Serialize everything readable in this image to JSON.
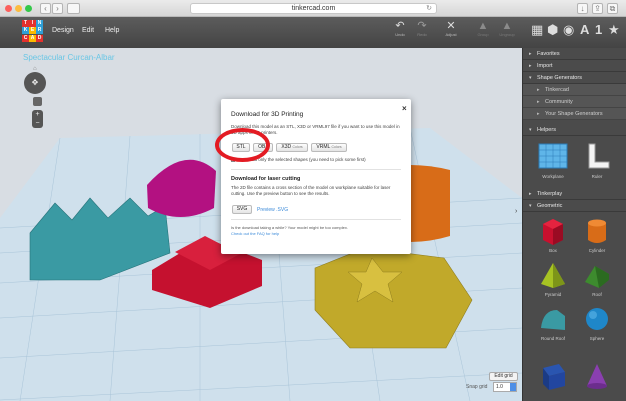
{
  "browser": {
    "url": "tinkercad.com",
    "back": "‹",
    "forward": "›",
    "reload": "↻",
    "share_icon": "share-icon",
    "colors": {
      "close": "#fc605c",
      "minimize": "#fdbc40",
      "zoom": "#34c84a"
    }
  },
  "app": {
    "logo_letters": [
      "T",
      "I",
      "N",
      "K",
      "E",
      "R",
      "C",
      "A",
      "D"
    ],
    "logo_colors": [
      "#e3312d",
      "#e3312d",
      "#2e9fd7",
      "#2e9fd7",
      "#fbb900",
      "#2e9fd7",
      "#e3312d",
      "#fbb900",
      "#e3312d"
    ],
    "menus": [
      "Design",
      "Edit",
      "Help"
    ],
    "tools": [
      {
        "label": "Undo",
        "glyph": "↶"
      },
      {
        "label": "Redo",
        "glyph": "↷"
      },
      {
        "label": "Adjust",
        "glyph": "✕"
      },
      {
        "label": "Group",
        "glyph": "▲"
      },
      {
        "label": "Ungroup",
        "glyph": "▲"
      }
    ],
    "accent": "#69c6e5"
  },
  "workplane": {
    "project_title": "Spectacular Curcan-Albar",
    "edit_grid": "Edit grid",
    "snap_label": "Snap grid",
    "snap_value": "1.0"
  },
  "panel": {
    "sections": [
      {
        "label": "Favorites",
        "expanded": false
      },
      {
        "label": "Import",
        "expanded": false
      },
      {
        "label": "Shape Generators",
        "expanded": true
      }
    ],
    "generators": [
      "Tinkercad",
      "Community",
      "Your Shape Generators"
    ],
    "helpers_title": "Helpers",
    "helpers": [
      "Workplane",
      "Ruler"
    ],
    "tinkerplay": "Tinkerplay",
    "geometric": "Geometric",
    "shapes": [
      "Box",
      "Cylinder",
      "Pyramid",
      "Roof",
      "Round Roof",
      "Sphere"
    ]
  },
  "modal": {
    "title": "Download for 3D Printing",
    "close": "×",
    "intro": "Download this model as an STL, X3D or VRML97 file if you want to use this model in 3D apps or 3D printers.",
    "buttons": [
      {
        "label": "STL",
        "sub": ""
      },
      {
        "label": "OBJ",
        "sub": ""
      },
      {
        "label": "X3D",
        "sub": "Colors"
      },
      {
        "label": "VRML",
        "sub": "Colors"
      }
    ],
    "selected_note": "Download only the selected shapes (you need to pick some first)",
    "laser_heading": "Download for laser cutting",
    "laser_text": "The 2D file contains a cross section of the model on workplane suitable for laser cutting. Use the preview button to see the results.",
    "svg_button": "SVG",
    "preview_link": "Preview .SVG",
    "note": "Is the download taking a while? Your model might be too complex.",
    "faq_link": "Check out the FAQ for help"
  }
}
